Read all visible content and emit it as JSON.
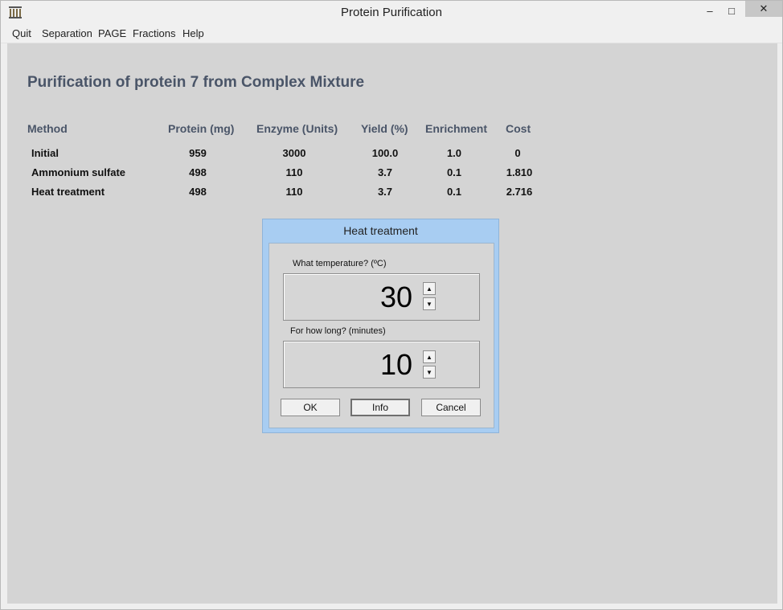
{
  "window": {
    "title": "Protein Purification",
    "controls": {
      "minimize": "–",
      "maximize": "□",
      "close": "✕"
    }
  },
  "menu": [
    "Quit",
    "Separation",
    "PAGE",
    "Fractions",
    "Help"
  ],
  "heading": "Purification of protein 7 from Complex Mixture",
  "table": {
    "columns": [
      "Method",
      "Protein (mg)",
      "Enzyme (Units)",
      "Yield (%)",
      "Enrichment",
      "Cost"
    ],
    "rows": [
      [
        "Initial",
        "959",
        "3000",
        "100.0",
        "1.0",
        "0"
      ],
      [
        "Ammonium sulfate",
        "498",
        "110",
        "3.7",
        "0.1",
        "1.810"
      ],
      [
        "Heat treatment",
        "498",
        "110",
        "3.7",
        "0.1",
        "2.716"
      ]
    ]
  },
  "dialog": {
    "title": "Heat treatment",
    "temperature_label": "What temperature? (ºC)",
    "temperature_value": "30",
    "duration_label": "For how long? (minutes)",
    "duration_value": "10",
    "spin_up": "▲",
    "spin_down": "▼",
    "buttons": {
      "ok": "OK",
      "info": "Info",
      "cancel": "Cancel"
    }
  },
  "colors": {
    "client_bg": "#d4d4d4",
    "heading": "#4a5568",
    "dialog_frame": "#a8cdf2",
    "close_button": "#c7c7c7"
  },
  "icons": {
    "app": "app-columns-icon",
    "minimize": "minimize-icon",
    "maximize": "maximize-icon",
    "close": "close-icon"
  }
}
